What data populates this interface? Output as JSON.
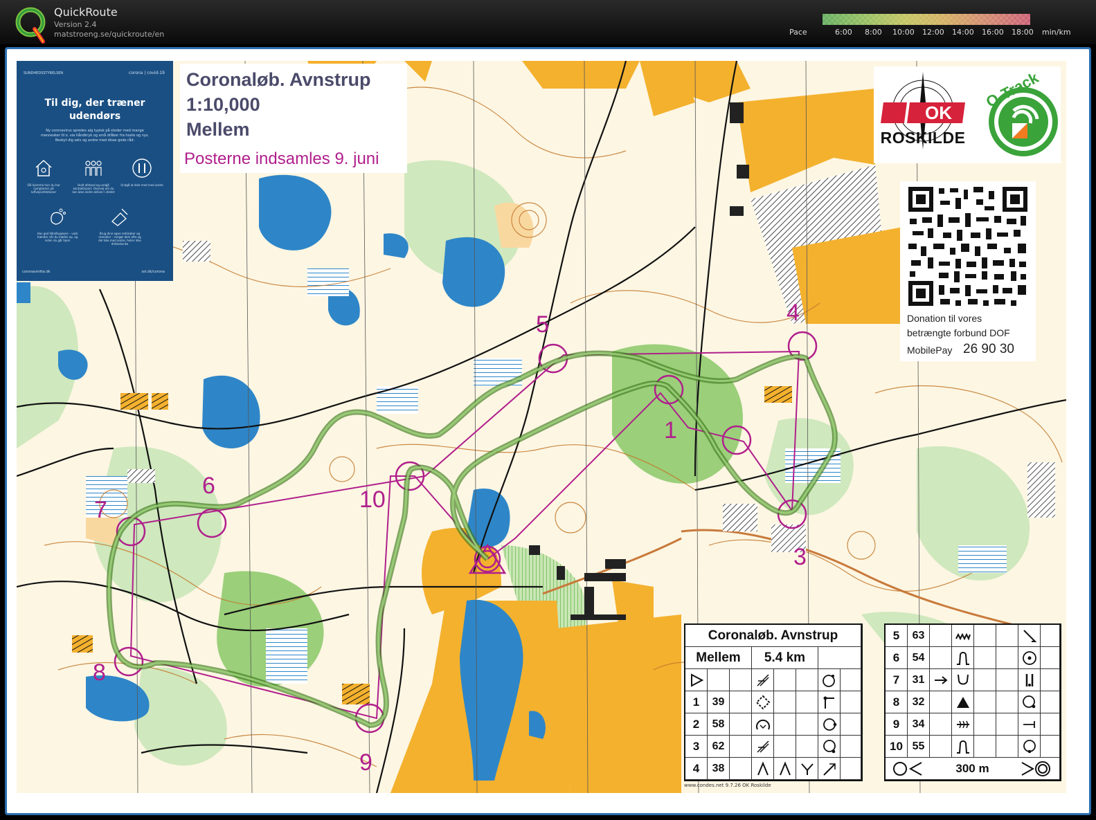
{
  "app": {
    "name": "QuickRoute",
    "version": "Version 2.4",
    "url": "matstroeng.se/quickroute/en"
  },
  "pace_scale": {
    "label": "Pace",
    "ticks": [
      "6:00",
      "8:00",
      "10:00",
      "12:00",
      "14:00",
      "16:00",
      "18:00"
    ],
    "unit": "min/km",
    "colors": [
      "#6fbf6a",
      "#d7d86b",
      "#e06a80"
    ]
  },
  "map": {
    "title": "Coronaløb. Avnstrup",
    "scale": "1:10,000",
    "course": "Mellem",
    "notice": "Posterne indsamles 9. juni",
    "control_labels": [
      "1",
      "3",
      "4",
      "5",
      "6",
      "7",
      "8",
      "9",
      "10"
    ],
    "colors": {
      "course": "#b01f8c",
      "route": "#5c8d2f",
      "water": "#2e86c8",
      "open": "#f4b12e",
      "forest": "#9bcf7a"
    }
  },
  "health_poster": {
    "org": "SUNDHEDSSTYRELSEN",
    "badge": "corona | covid-19",
    "title": "Til dig, der træner udendørs",
    "text": "Ny coronavirus spredes alg typisk på steder med mange mennesker til o. via håndkryk og små dråber fra hoste og nys. Beskyt dig selv og andre med disse gode råd:",
    "captions": [
      "Slå hjemme hvis du har symptomer på luftvejsinfektioner",
      "Hold afstand og undgå kontakt/sport. Overvej om du kan løse andre aktiver i stedet",
      "Undgå at dele med med andre",
      "Hav god håndhygiejne – vask hænder når du mødes op, og inden du går hjem",
      "Brug dine egne redskaber og remedier – rengør dem ofte og del ikke med andre, heller ikke drikkedunke"
    ],
    "footer_left": "coronasmitte.dk",
    "footer_right": "sst.dk/corona"
  },
  "logos": {
    "club": "ROSKILDE",
    "club_badge": "OK",
    "app_logo": "O-Track"
  },
  "donation": {
    "line1": "Donation til vores",
    "line2": "betrængte forbund DOF",
    "mobilepay_label": "MobilePay",
    "mobilepay_number": "26 90 30"
  },
  "control_description": {
    "title": "Coronaløb. Avnstrup",
    "class": "Mellem",
    "length": "5.4 km",
    "rows_left": [
      {
        "num": "1",
        "code": "39"
      },
      {
        "num": "2",
        "code": "58"
      },
      {
        "num": "3",
        "code": "62"
      },
      {
        "num": "4",
        "code": "38"
      }
    ],
    "rows_right": [
      {
        "num": "5",
        "code": "63"
      },
      {
        "num": "6",
        "code": "54"
      },
      {
        "num": "7",
        "code": "31"
      },
      {
        "num": "8",
        "code": "32"
      },
      {
        "num": "9",
        "code": "34"
      },
      {
        "num": "10",
        "code": "55"
      }
    ],
    "finish": "300 m",
    "credit": "www.condes.net 9.7.26 OK Roskilde"
  }
}
